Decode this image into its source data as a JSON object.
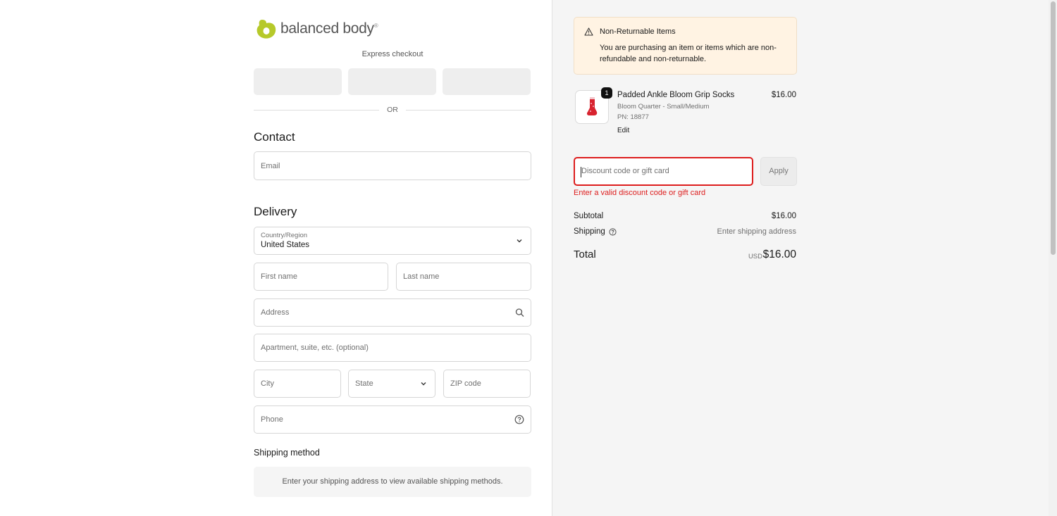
{
  "brand": {
    "name": "balanced body",
    "reg": "®",
    "accent": "#b6c92a"
  },
  "express": {
    "label": "Express checkout",
    "or_label": "OR"
  },
  "contact": {
    "title": "Contact",
    "email_placeholder": "Email"
  },
  "delivery": {
    "title": "Delivery",
    "country_label": "Country/Region",
    "country_value": "United States",
    "first_name_placeholder": "First name",
    "last_name_placeholder": "Last name",
    "address_placeholder": "Address",
    "apartment_placeholder": "Apartment, suite, etc. (optional)",
    "city_placeholder": "City",
    "state_placeholder": "State",
    "zip_placeholder": "ZIP code",
    "phone_placeholder": "Phone"
  },
  "shipping_method": {
    "title": "Shipping method",
    "message": "Enter your shipping address to view available shipping methods."
  },
  "notice": {
    "title": "Non-Returnable Items",
    "body": "You are purchasing an item or items which are non-refundable and non-returnable."
  },
  "cart_item": {
    "quantity": "1",
    "name": "Padded Ankle Bloom Grip Socks",
    "variant": "Bloom Quarter - Small/Medium",
    "part_number": "PN: 18877",
    "edit_label": "Edit",
    "price": "$16.00"
  },
  "discount": {
    "placeholder": "Discount code or gift card",
    "apply_label": "Apply",
    "error": "Enter a valid discount code or gift card",
    "error_color": "#dd1d1d"
  },
  "summary": {
    "subtotal_label": "Subtotal",
    "subtotal_value": "$16.00",
    "shipping_label": "Shipping",
    "shipping_value": "Enter shipping address",
    "total_label": "Total",
    "total_currency": "USD",
    "total_value": "$16.00"
  }
}
